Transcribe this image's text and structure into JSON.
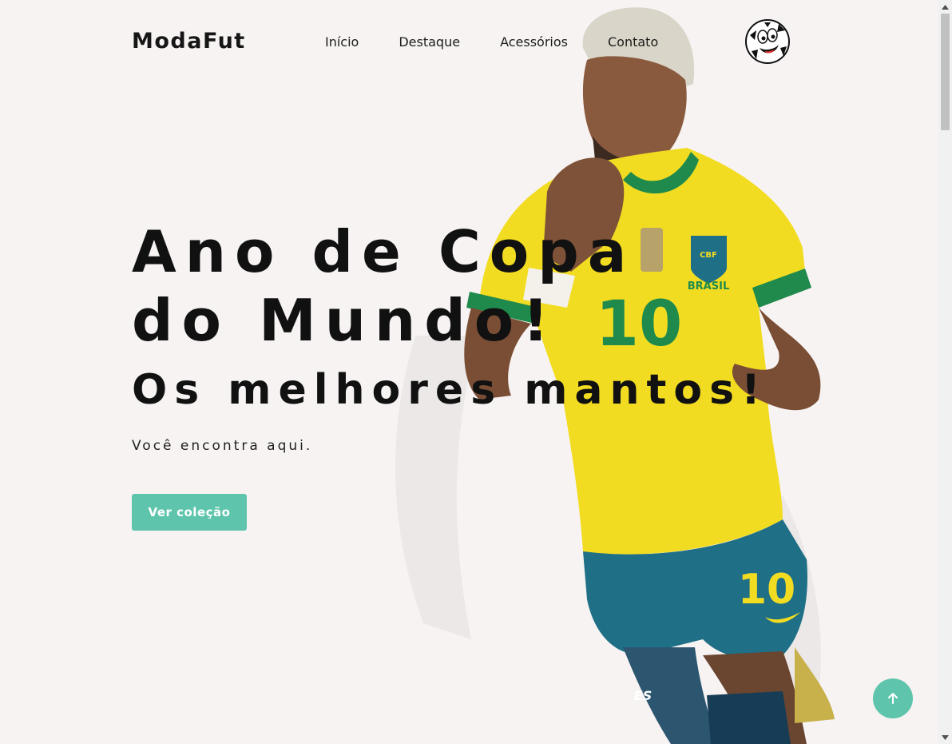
{
  "header": {
    "logo": "ModaFut",
    "nav": [
      "Início",
      "Destaque",
      "Acessórios",
      "Contato"
    ],
    "avatar_icon": "soccer-ball-mascot-icon"
  },
  "hero": {
    "title": "Ano de Copa do Mundo!",
    "subtitle": "Os melhores mantos!",
    "text": "Você encontra aqui.",
    "cta_label": "Ver coleção",
    "jersey_number": "10",
    "jersey_badge": "CBF",
    "jersey_country": "BRASIL",
    "sock_text": "ES"
  },
  "back_to_top_icon": "arrow-up-icon",
  "colors": {
    "background": "#f7f3f3",
    "accent": "#5ec5ac",
    "jersey_yellow": "#f2dc22",
    "shorts_blue": "#1f6f86",
    "jersey_green": "#1f8a4c"
  }
}
